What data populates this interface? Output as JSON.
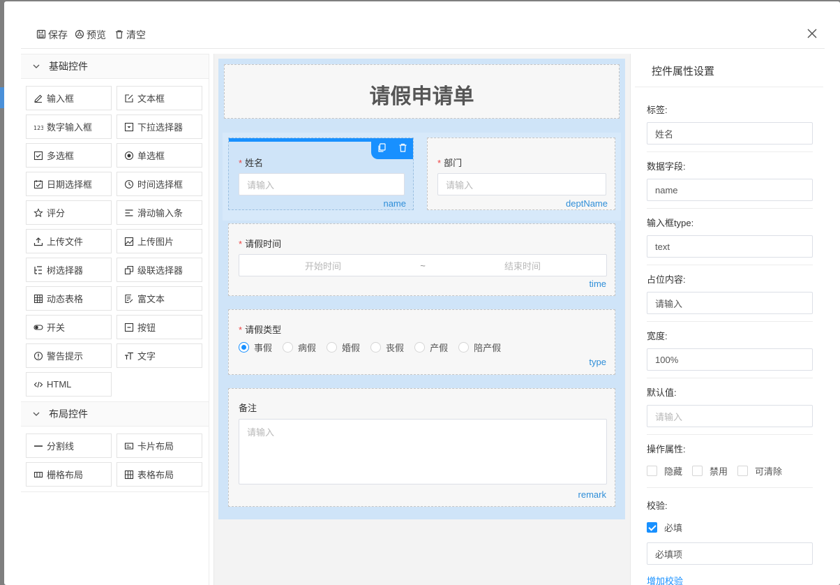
{
  "toolbar": {
    "save_label": "保存",
    "preview_label": "预览",
    "clear_label": "清空"
  },
  "left_panel": {
    "basic_group": {
      "title": "基础控件",
      "items": [
        {
          "label": "输入框",
          "icon": "edit-icon"
        },
        {
          "label": "文本框",
          "icon": "edit-square-icon"
        },
        {
          "label": "数字输入框",
          "icon": "number-icon"
        },
        {
          "label": "下拉选择器",
          "icon": "dropdown-icon"
        },
        {
          "label": "多选框",
          "icon": "checkbox-icon"
        },
        {
          "label": "单选框",
          "icon": "radio-icon"
        },
        {
          "label": "日期选择框",
          "icon": "calendar-icon"
        },
        {
          "label": "时间选择框",
          "icon": "clock-icon"
        },
        {
          "label": "评分",
          "icon": "star-icon"
        },
        {
          "label": "滑动输入条",
          "icon": "slider-icon"
        },
        {
          "label": "上传文件",
          "icon": "upload-icon"
        },
        {
          "label": "上传图片",
          "icon": "image-icon"
        },
        {
          "label": "树选择器",
          "icon": "tree-icon"
        },
        {
          "label": "级联选择器",
          "icon": "cascader-icon"
        },
        {
          "label": "动态表格",
          "icon": "table-icon"
        },
        {
          "label": "富文本",
          "icon": "rich-text-icon"
        },
        {
          "label": "开关",
          "icon": "switch-icon"
        },
        {
          "label": "按钮",
          "icon": "button-icon"
        },
        {
          "label": "警告提示",
          "icon": "alert-icon"
        },
        {
          "label": "文字",
          "icon": "text-icon"
        },
        {
          "label": "HTML",
          "icon": "code-icon"
        }
      ]
    },
    "layout_group": {
      "title": "布局控件",
      "items": [
        {
          "label": "分割线",
          "icon": "divider-icon"
        },
        {
          "label": "卡片布局",
          "icon": "card-icon"
        },
        {
          "label": "栅格布局",
          "icon": "grid-icon"
        },
        {
          "label": "表格布局",
          "icon": "table-layout-icon"
        }
      ]
    }
  },
  "canvas": {
    "form_title": "请假申请单",
    "name_field": {
      "label": "姓名",
      "placeholder": "请输入",
      "key": "name"
    },
    "dept_field": {
      "label": "部门",
      "placeholder": "请输入",
      "key": "deptName"
    },
    "time_field": {
      "label": "请假时间",
      "start": "开始时间",
      "separator": "~",
      "end": "结束时间",
      "key": "time"
    },
    "type_field": {
      "label": "请假类型",
      "options": [
        "事假",
        "病假",
        "婚假",
        "丧假",
        "产假",
        "陪产假"
      ],
      "selected": "事假",
      "key": "type"
    },
    "remark_field": {
      "label": "备注",
      "placeholder": "请输入",
      "key": "remark"
    }
  },
  "right_panel": {
    "title": "控件属性设置",
    "label_label": "标签:",
    "label_value": "姓名",
    "field_label": "数据字段:",
    "field_value": "name",
    "type_label": "输入框type:",
    "type_value": "text",
    "placeholder_label": "占位内容:",
    "placeholder_value": "请输入",
    "width_label": "宽度:",
    "width_value": "100%",
    "default_label": "默认值:",
    "default_placeholder": "请输入",
    "ops_label": "操作属性:",
    "ops": [
      "隐藏",
      "禁用",
      "可清除"
    ],
    "validate_label": "校验:",
    "required_label": "必填",
    "required_placeholder": "必填项",
    "add_validation": "增加校验"
  },
  "colors": {
    "accent": "#1890ff",
    "selection_bg": "#cfe4f8",
    "required": "#e44444"
  }
}
